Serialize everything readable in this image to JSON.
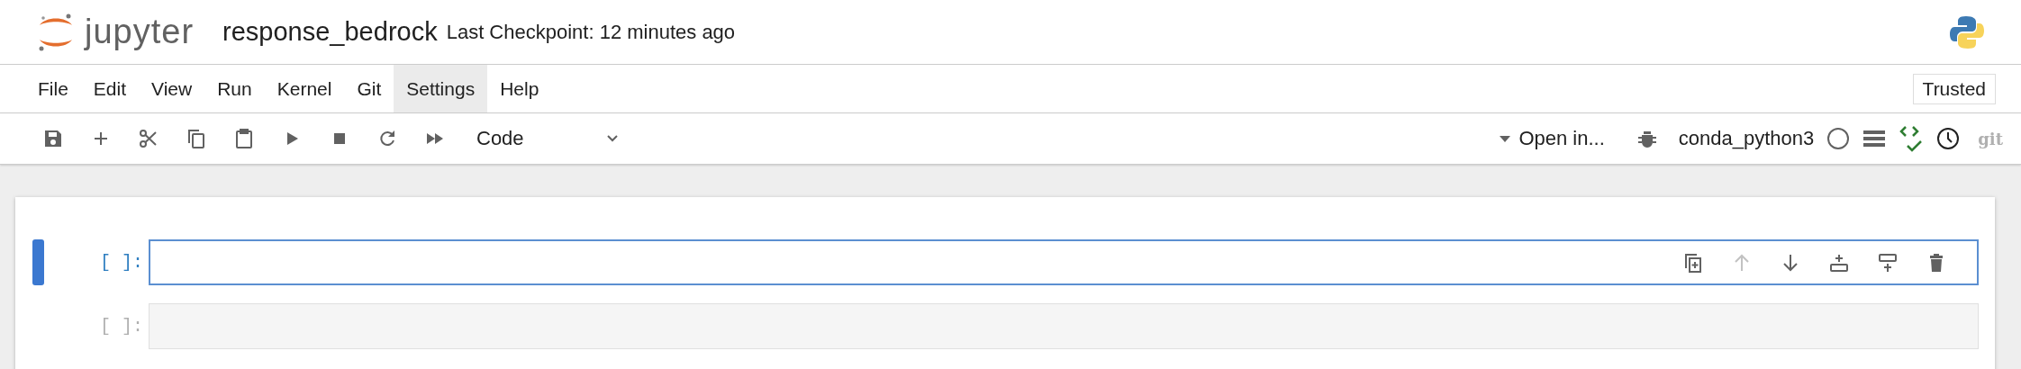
{
  "header": {
    "logo_text": "jupyter",
    "notebook_name": "response_bedrock",
    "checkpoint": "Last Checkpoint: 12 minutes ago"
  },
  "menu": [
    {
      "label": "File",
      "selected": false
    },
    {
      "label": "Edit",
      "selected": false
    },
    {
      "label": "View",
      "selected": false
    },
    {
      "label": "Run",
      "selected": false
    },
    {
      "label": "Kernel",
      "selected": false
    },
    {
      "label": "Git",
      "selected": false
    },
    {
      "label": "Settings",
      "selected": true
    },
    {
      "label": "Help",
      "selected": false
    }
  ],
  "trusted": "Trusted",
  "toolbar": {
    "cell_type": "Code",
    "open_in": "Open in...",
    "kernel": "conda_python3",
    "kernel_busy": false,
    "git": "git"
  },
  "cells": [
    {
      "prompt": "[ ]:",
      "selected": true
    },
    {
      "prompt": "[ ]:",
      "selected": false
    }
  ],
  "cell_toolbar": [
    {
      "kind": "duplicate",
      "disabled": false
    },
    {
      "kind": "move_up",
      "disabled": true
    },
    {
      "kind": "move_down",
      "disabled": false
    },
    {
      "kind": "insert_above",
      "disabled": false
    },
    {
      "kind": "insert_below",
      "disabled": false
    },
    {
      "kind": "delete",
      "disabled": false
    }
  ]
}
